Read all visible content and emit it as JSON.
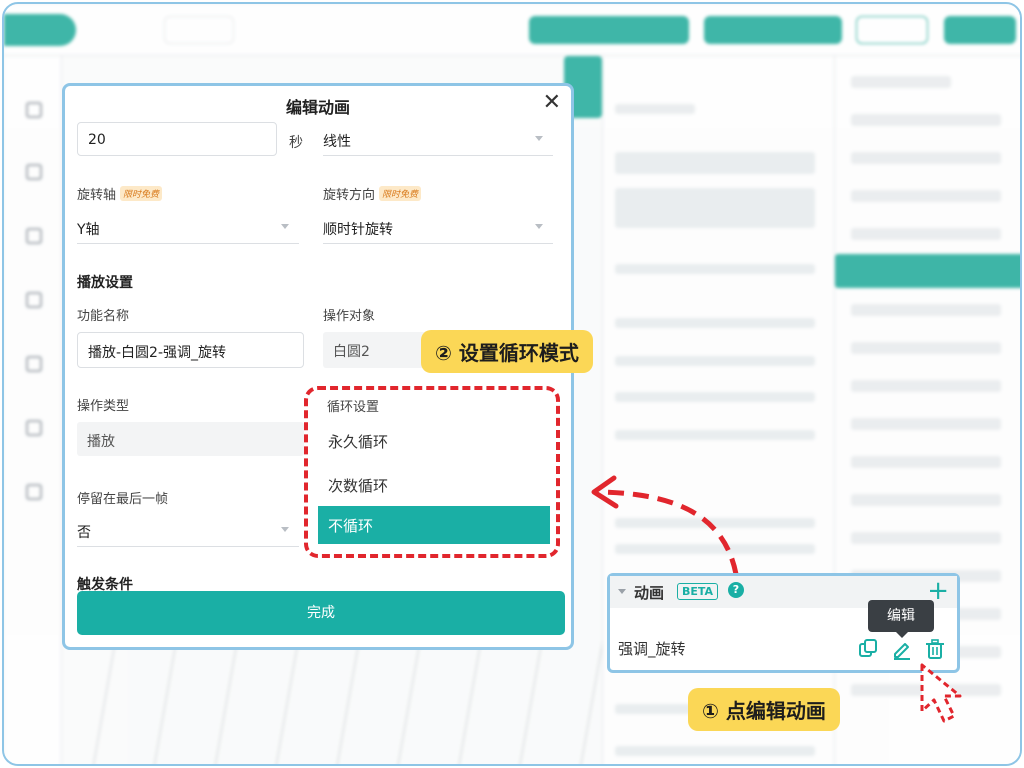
{
  "dialog": {
    "title": "编辑动画",
    "duration_value": "20",
    "duration_unit": "秒",
    "easing_value": "线性",
    "rotation_axis_label": "旋转轴",
    "rotation_axis_badge": "限时免费",
    "rotation_axis_value": "Y轴",
    "rotation_dir_label": "旋转方向",
    "rotation_dir_badge": "限时免费",
    "rotation_dir_value": "顺时针旋转",
    "play_section": "播放设置",
    "func_name_label": "功能名称",
    "func_name_value": "播放-白圆2-强调_旋转",
    "target_label": "操作对象",
    "target_value": "白圆2",
    "op_type_label": "操作类型",
    "op_type_value": "播放",
    "loop_label": "循环设置",
    "loop_options": [
      "永久循环",
      "次数循环",
      "不循环"
    ],
    "loop_selected": "不循环",
    "stay_label": "停留在最后一帧",
    "stay_value": "否",
    "trigger_section": "触发条件",
    "done_button": "完成"
  },
  "anim_panel": {
    "title": "动画",
    "beta": "BETA",
    "help": "?",
    "item_name": "强调_旋转",
    "tooltip": "编辑"
  },
  "callouts": {
    "step1": "① 点编辑动画",
    "step2": "② 设置循环模式"
  },
  "colors": {
    "accent": "#1aafa5",
    "highlight": "#e1262d",
    "callout_bg": "#fbd756"
  }
}
